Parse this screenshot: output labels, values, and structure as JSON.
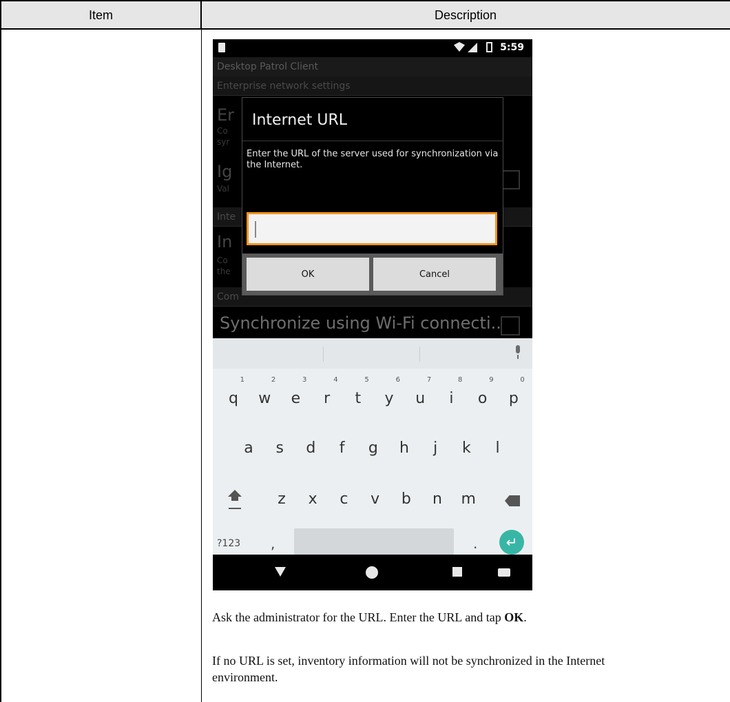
{
  "table": {
    "header_item": "Item",
    "header_description": "Description"
  },
  "phone": {
    "status_time": "5:59",
    "app_title": "Desktop Patrol Client",
    "section_enterprise": "Enterprise network settings",
    "bg_item1_title": "Er",
    "bg_item1_sub1": "Co",
    "bg_item1_sub2": "syr",
    "bg_item2_title": "Ig",
    "bg_item2_sub": "Val",
    "bg_section2": "Inte",
    "bg_item3_title": "In",
    "bg_item3_sub1": "Co",
    "bg_item3_sub2": "the",
    "bg_section3": "Com",
    "sync_text": "Synchronize using Wi-Fi connecti..",
    "dialog": {
      "title": "Internet URL",
      "message": "Enter the URL of the server used for synchronization via the Internet.",
      "input_value": "",
      "ok_label": "OK",
      "cancel_label": "Cancel"
    },
    "keyboard": {
      "row1": [
        {
          "k": "q",
          "n": "1"
        },
        {
          "k": "w",
          "n": "2"
        },
        {
          "k": "e",
          "n": "3"
        },
        {
          "k": "r",
          "n": "4"
        },
        {
          "k": "t",
          "n": "5"
        },
        {
          "k": "y",
          "n": "6"
        },
        {
          "k": "u",
          "n": "7"
        },
        {
          "k": "i",
          "n": "8"
        },
        {
          "k": "o",
          "n": "9"
        },
        {
          "k": "p",
          "n": "0"
        }
      ],
      "row2": [
        "a",
        "s",
        "d",
        "f",
        "g",
        "h",
        "j",
        "k",
        "l"
      ],
      "row3": [
        "z",
        "x",
        "c",
        "v",
        "b",
        "n",
        "m"
      ],
      "symbols_label": "?123",
      "comma": ",",
      "period": ".",
      "enter_glyph": "↵"
    }
  },
  "instructions": {
    "para1_prefix": "Ask the administrator for the URL. Enter the URL and tap ",
    "para1_bold": "OK",
    "para1_suffix": ".",
    "para2_line1": "If no URL is set, inventory information will not be synchronized in the Internet",
    "para2_line2": "environment."
  }
}
